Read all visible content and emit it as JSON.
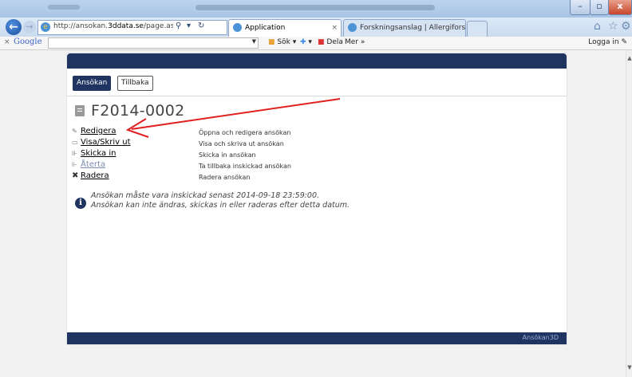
{
  "browser": {
    "address_url_plain": "http://ansokan.",
    "address_url_host": "3ddata.se",
    "address_url_rest": "/page.asp?goto=ansöke",
    "tabs": [
      {
        "label": "Application",
        "active": true
      },
      {
        "label": "Forskningsanslag | Allergiforsk...",
        "active": false
      }
    ]
  },
  "google_bar": {
    "brand": "Google",
    "search_label": "Sök",
    "share_label": "Dela",
    "more_label": "Mer »",
    "login_label": "Logga in"
  },
  "app": {
    "buttons": {
      "primary": "Ansökan",
      "secondary": "Tillbaka"
    },
    "title": "F2014-0002",
    "actions": [
      {
        "label": "Redigera",
        "icon": "pencil-icon",
        "desc": "Öppna och redigera ansökan",
        "enabled": true
      },
      {
        "label": "Visa/Skriv ut",
        "icon": "printer-icon",
        "desc": "Visa och skriva ut ansökan",
        "enabled": true
      },
      {
        "label": "Skicka in",
        "icon": "send-icon",
        "desc": "Skicka in ansökan",
        "enabled": true
      },
      {
        "label": "Återta",
        "icon": "withdraw-icon",
        "desc": "Ta tillbaka inskickad ansökan",
        "enabled": false
      },
      {
        "label": "Radera",
        "icon": "delete-icon",
        "desc": "Radera ansökan",
        "enabled": true
      }
    ],
    "notice": {
      "line1": "Ansökan måste vara inskickad senast 2014-09-18 23:59:00.",
      "line2": "Ansökan kan inte ändras, skickas in eller raderas efter detta datum."
    },
    "footer": "Ansökan3D"
  },
  "colors": {
    "brand_navy": "#1f3461",
    "annotation_red": "#e02020"
  }
}
